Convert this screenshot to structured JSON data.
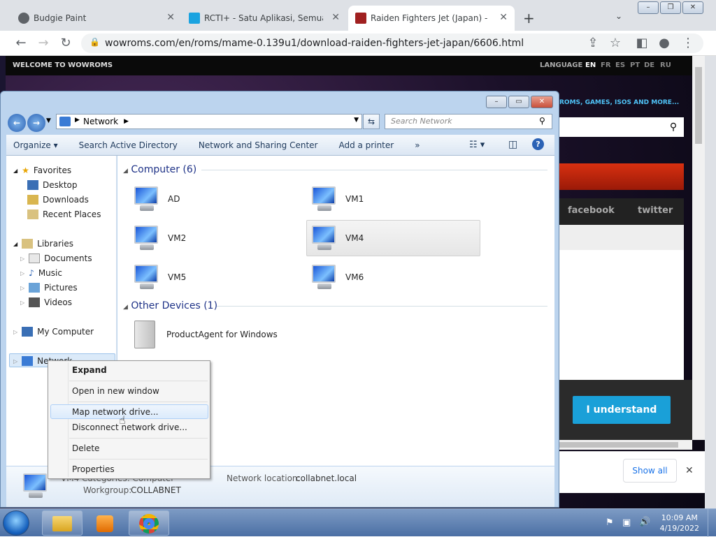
{
  "browser": {
    "tabs": [
      {
        "label": "Budgie Paint"
      },
      {
        "label": "RCTI+ - Satu Aplikasi, Semua Hib"
      },
      {
        "label": "Raiden Fighters Jet (Japan) - MA"
      }
    ],
    "url": "wowroms.com/en/roms/mame-0.139u1/download-raiden-fighters-jet-japan/6606.html",
    "new_tab": "+"
  },
  "webpage": {
    "welcome": "WELCOME TO WOWROMS",
    "language_label": "LANGUAGE",
    "languages": [
      "EN",
      "FR",
      "ES",
      "PT",
      "DE",
      "RU"
    ],
    "tagline": "ROMS, GAMES, ISOS AND MORE...",
    "facebook": "facebook",
    "twitter": "twitter",
    "understand_button": "I understand",
    "show_all": "Show all"
  },
  "explorer": {
    "breadcrumb": "Network",
    "search_placeholder": "Search Network",
    "commands": [
      "Organize ▾",
      "Search Active Directory",
      "Network and Sharing Center",
      "Add a printer",
      "»"
    ],
    "nav": {
      "favorites": "Favorites",
      "desktop": "Desktop",
      "downloads": "Downloads",
      "recent": "Recent Places",
      "libraries": "Libraries",
      "documents": "Documents",
      "music": "Music",
      "pictures": "Pictures",
      "videos": "Videos",
      "my_computer": "My Computer",
      "network": "Network"
    },
    "group_computer": "Computer (6)",
    "computers": [
      "AD",
      "VM1",
      "VM2",
      "VM4",
      "VM5",
      "VM6"
    ],
    "group_other": "Other Devices (1)",
    "other_device": "ProductAgent for Windows",
    "details": {
      "categories": "VM4   Categories: Computer",
      "workgroup_label": "Workgroup:",
      "workgroup_value": "COLLABNET",
      "location_label": "Network location:",
      "location_value": "collabnet.local"
    }
  },
  "context_menu": {
    "items": [
      "Expand",
      "Open in new window",
      "Map network drive...",
      "Disconnect network drive...",
      "Delete",
      "Properties"
    ]
  },
  "taskbar": {
    "time": "10:09 AM",
    "date": "4/19/2022"
  }
}
